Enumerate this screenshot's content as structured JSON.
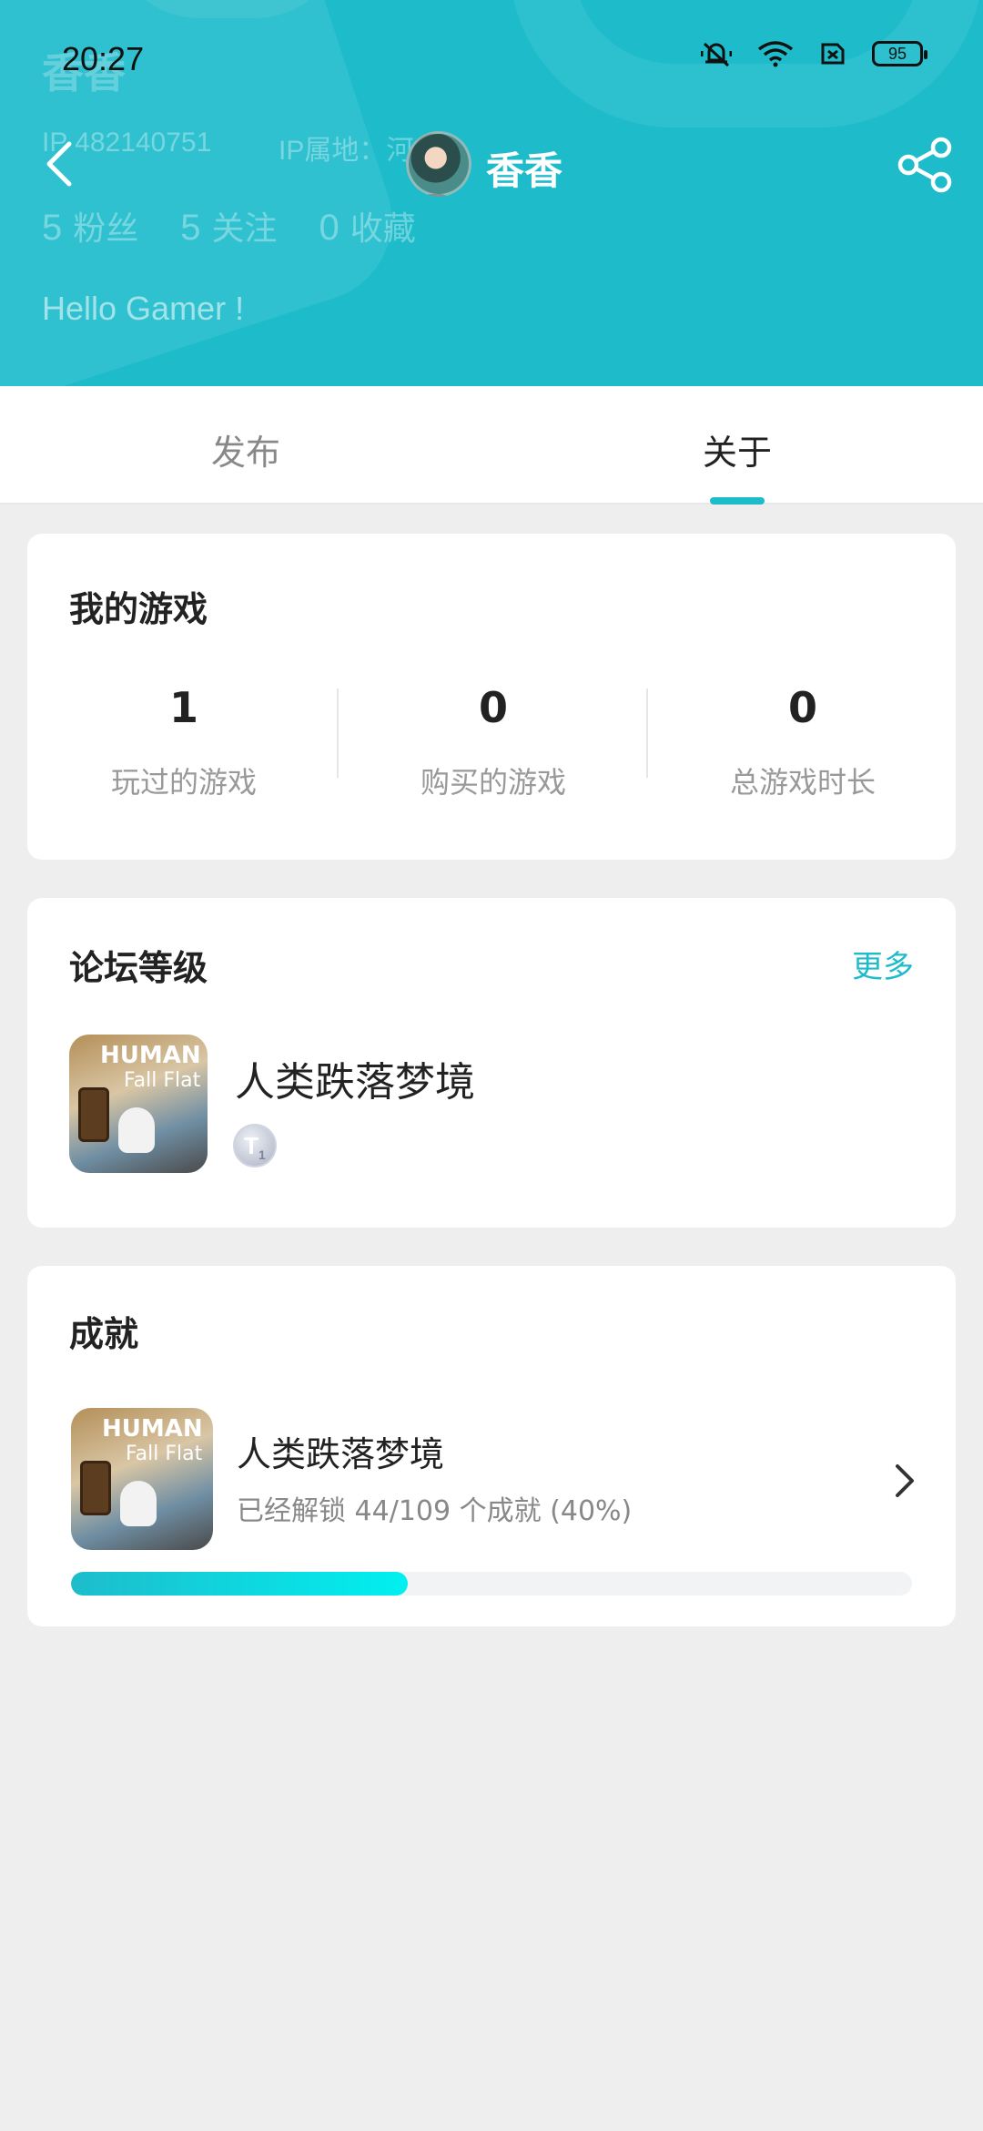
{
  "status_bar": {
    "time": "20:27",
    "battery": "95",
    "icons": [
      "mute-icon",
      "wifi-icon",
      "sim-icon",
      "battery-icon"
    ]
  },
  "profile_ghost": {
    "name": "香香",
    "ip_id": "IP 482140751",
    "ip_region": "IP属地：河",
    "fans_count": "5",
    "fans_label": "粉丝",
    "follow_count": "5",
    "follow_label": "关注",
    "fav_count": "0",
    "fav_label": "收藏",
    "bio": "Hello Gamer !"
  },
  "header": {
    "username": "香香",
    "accent_color": "#1ebccb"
  },
  "tabs": [
    {
      "label": "发布",
      "active": false
    },
    {
      "label": "关于",
      "active": true
    }
  ],
  "my_games": {
    "title": "我的游戏",
    "stats": [
      {
        "value": "1",
        "label": "玩过的游戏"
      },
      {
        "value": "0",
        "label": "购买的游戏"
      },
      {
        "value": "0",
        "label": "总游戏时长"
      }
    ]
  },
  "forum_level": {
    "title": "论坛等级",
    "more_label": "更多",
    "game_name": "人类跌落梦境",
    "badge_letter": "T",
    "badge_level": "1",
    "icon_text_1": "HUMAN",
    "icon_text_2": "Fall Flat"
  },
  "achievements": {
    "title": "成就",
    "game_name": "人类跌落梦境",
    "subtitle": "已经解锁 44/109 个成就 (40%)",
    "progress_fraction": 0.4,
    "icon_text_1": "HUMAN",
    "icon_text_2": "Fall Flat"
  }
}
